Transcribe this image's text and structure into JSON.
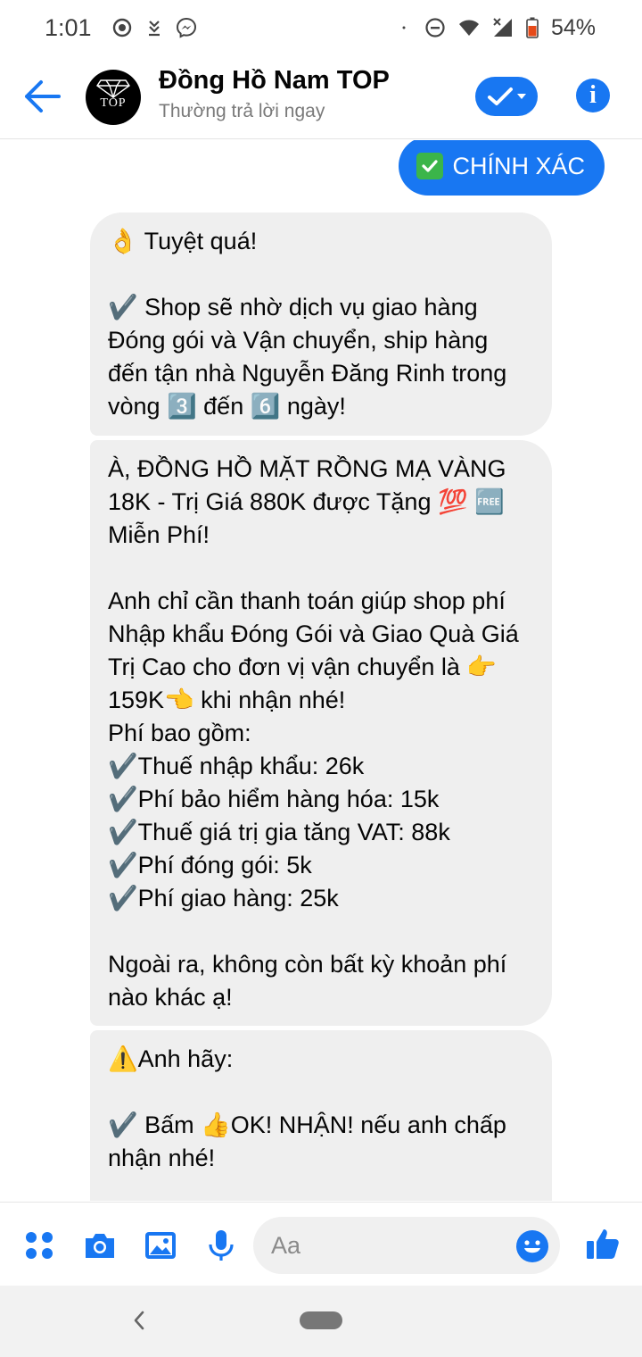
{
  "status_bar": {
    "time": "1:01",
    "battery": "54%",
    "icons": [
      "settings-icon",
      "download-icon",
      "messenger-icon",
      "dot-icon",
      "do-not-disturb-icon",
      "wifi-icon",
      "signal-icon",
      "battery-icon"
    ]
  },
  "header": {
    "title": "Đồng Hồ Nam TOP",
    "subtitle": "Thường trả lời ngay",
    "avatar_text": "TOP",
    "back_icon": "back-arrow-icon",
    "check_icon": "checkmark-dropdown-icon",
    "info_icon": "info-icon"
  },
  "messages": {
    "outgoing_label": "CHÍNH XÁC",
    "bubble1": "👌 Tuyệt quá!\n\n✔️ Shop sẽ nhờ dịch vụ giao hàng Đóng gói và Vận chuyển, ship hàng đến tận nhà Nguyễn Đăng Rinh trong vòng 3️⃣ đến 6️⃣ ngày!",
    "bubble2": "À, ĐỒNG HỒ MẶT RỒNG MẠ VÀNG 18K - Trị Giá 880K được Tặng 💯 🆓 Miễn Phí!\n\nAnh chỉ cần thanh toán giúp shop phí Nhập khẩu Đóng Gói và Giao Quà Giá Trị Cao cho đơn vị vận chuyển là 👉 159K👈 khi nhận nhé!\nPhí bao gồm:\n✔️Thuế nhập khẩu: 26k\n✔️Phí bảo hiểm hàng hóa: 15k\n✔️Thuế giá trị gia tăng VAT: 88k\n✔️Phí đóng gói: 5k\n✔️Phí giao hàng: 25k\n\nNgoài ra, không còn bất kỳ khoản phí nào khác ạ!",
    "bubble3": "⚠️Anh hãy:\n\n✔️ Bấm 👍OK! NHẬN! nếu anh chấp nhận nhé!"
  },
  "composer": {
    "placeholder": "Aa",
    "icons": [
      "apps-icon",
      "camera-icon",
      "gallery-icon",
      "microphone-icon",
      "emoji-icon",
      "thumbs-up-icon"
    ]
  },
  "colors": {
    "accent": "#1877f2",
    "bubble_bg": "#efefef"
  }
}
